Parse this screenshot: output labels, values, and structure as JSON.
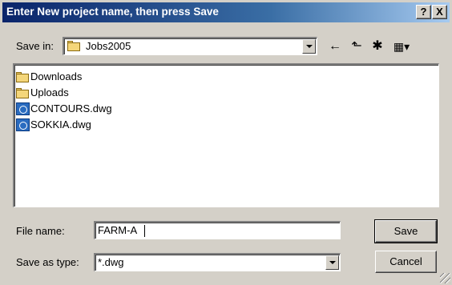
{
  "window": {
    "title": "Enter New project name, then press Save",
    "help_button": "?",
    "close_button": "X"
  },
  "save_in": {
    "label": "Save in:",
    "value": "Jobs2005",
    "icon": "folder-icon"
  },
  "toolbar": {
    "back_icon": "←",
    "up_folder_icon": "⬑",
    "new_folder_icon": "✱",
    "view_menu_icon": "▦▾"
  },
  "files": [
    {
      "name": "Downloads",
      "icon": "folder-icon"
    },
    {
      "name": "Uploads",
      "icon": "folder-icon"
    },
    {
      "name": "CONTOURS.dwg",
      "icon": "dwg-file-icon"
    },
    {
      "name": "SOKKIA.dwg",
      "icon": "dwg-file-icon"
    }
  ],
  "file_name": {
    "label": "File name:",
    "value": "FARM-A"
  },
  "save_as_type": {
    "label": "Save as type:",
    "value": "*.dwg"
  },
  "buttons": {
    "save": "Save",
    "cancel": "Cancel"
  }
}
